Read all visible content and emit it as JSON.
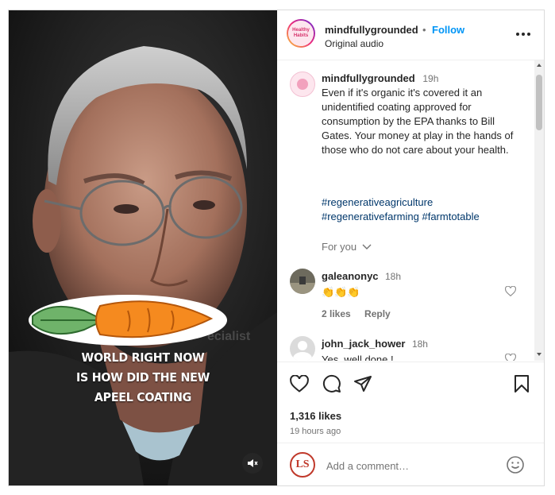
{
  "header": {
    "username": "mindfullygrounded",
    "dot": "•",
    "follow_label": "Follow",
    "audio": "Original audio",
    "avatar_text": "Healthy Habits"
  },
  "media": {
    "overlay_lines": [
      "WORLD RIGHT NOW",
      "IS HOW DID THE NEW",
      "APEEL COATING"
    ],
    "watermark": "ecialist",
    "mute_icon": "speaker-muted-icon"
  },
  "caption": {
    "username": "mindfullygrounded",
    "time": "19h",
    "text": "Even if it's organic it's covered it an unidentified coating approved for consumption by the EPA thanks to Bill Gates. Your money at play in the hands of those who do not care about your health.",
    "hashtag_1": "#regenerativeagriculture",
    "hashtag_2": "#regenerativefarming",
    "hashtag_3": "#farmtotable"
  },
  "for_you": "For you",
  "comments": [
    {
      "username": "galeanonyc",
      "time": "18h",
      "text": "👏👏👏",
      "likes": "2 likes",
      "reply": "Reply"
    },
    {
      "username": "john_jack_hower",
      "time": "18h",
      "text": "Yes, well done !"
    }
  ],
  "actions": {
    "likes": "1,316 likes",
    "time_ago": "19 hours ago"
  },
  "add_comment": {
    "placeholder": "Add a comment…",
    "avatar_text": "LS"
  },
  "colors": {
    "follow": "#0095f6",
    "hashtag": "#00376b",
    "carrot": "#f58a1f"
  }
}
